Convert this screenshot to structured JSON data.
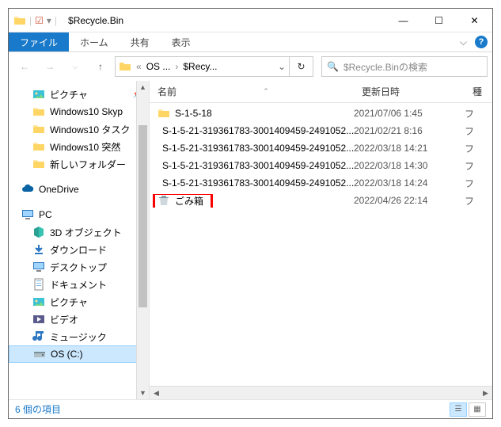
{
  "title": "$Recycle.Bin",
  "ribbon": {
    "file": "ファイル",
    "home": "ホーム",
    "share": "共有",
    "view": "表示"
  },
  "breadcrumb": {
    "p1": "OS ...",
    "p2": "$Recy..."
  },
  "search": {
    "placeholder": "$Recycle.Binの検索"
  },
  "columns": {
    "name": "名前",
    "date": "更新日時",
    "type": "種"
  },
  "sidebar": {
    "quick": "ピクチャ",
    "items": [
      "Windows10 Skyp",
      "Windows10 タスク",
      "Windows10 突然",
      "新しいフォルダー"
    ],
    "onedrive": "OneDrive",
    "pc": "PC",
    "pcitems": [
      "3D オブジェクト",
      "ダウンロード",
      "デスクトップ",
      "ドキュメント",
      "ピクチャ",
      "ビデオ",
      "ミュージック",
      "OS (C:)"
    ]
  },
  "rows": [
    {
      "name": "S-1-5-18",
      "date": "2021/07/06 1:45",
      "type": "フ",
      "icon": "folder"
    },
    {
      "name": "S-1-5-21-319361783-3001409459-2491052...",
      "date": "2021/02/21 8:16",
      "type": "フ",
      "icon": "folder"
    },
    {
      "name": "S-1-5-21-319361783-3001409459-2491052...",
      "date": "2022/03/18 14:21",
      "type": "フ",
      "icon": "folder"
    },
    {
      "name": "S-1-5-21-319361783-3001409459-2491052...",
      "date": "2022/03/18 14:30",
      "type": "フ",
      "icon": "folder"
    },
    {
      "name": "S-1-5-21-319361783-3001409459-2491052...",
      "date": "2022/03/18 14:24",
      "type": "フ",
      "icon": "folder"
    },
    {
      "name": "ごみ箱",
      "date": "2022/04/26 22:14",
      "type": "フ",
      "icon": "recycle",
      "hl": true
    }
  ],
  "status": "6 個の項目"
}
